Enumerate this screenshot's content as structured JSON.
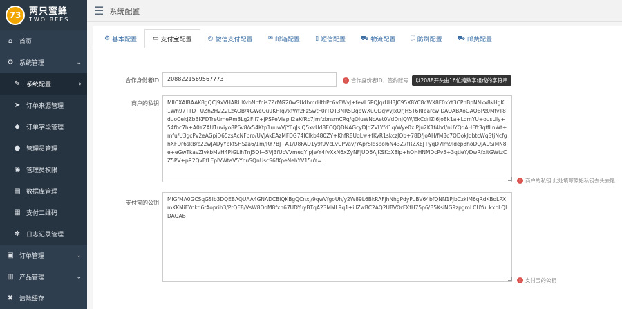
{
  "brand": {
    "badge": "73",
    "name_cn": "两只蜜蜂",
    "name_en": "TWO BEES"
  },
  "sidebar": {
    "items": [
      {
        "label": "首页",
        "icon": "home-icon",
        "glyph": "⌂",
        "arrow": ""
      },
      {
        "label": "系统管理",
        "icon": "gear-icon",
        "glyph": "⚙",
        "arrow": "⌄"
      },
      {
        "label": "系统配置",
        "icon": "wrench-icon",
        "glyph": "✎",
        "arrow": "›"
      },
      {
        "label": "订单来源管理",
        "icon": "send-icon",
        "glyph": "➤",
        "arrow": ""
      },
      {
        "label": "订单字段管理",
        "icon": "tag-icon",
        "glyph": "◆",
        "arrow": ""
      },
      {
        "label": "管理员管理",
        "icon": "user-icon",
        "glyph": "●",
        "arrow": ""
      },
      {
        "label": "管理员权限",
        "icon": "users-icon",
        "glyph": "◉",
        "arrow": ""
      },
      {
        "label": "数据库管理",
        "icon": "database-icon",
        "glyph": "▤",
        "arrow": ""
      },
      {
        "label": "支付二维码",
        "icon": "qrcode-icon",
        "glyph": "▦",
        "arrow": ""
      },
      {
        "label": "日志记录管理",
        "icon": "paw-icon",
        "glyph": "✽",
        "arrow": ""
      },
      {
        "label": "订单管理",
        "icon": "cart-icon",
        "glyph": "▣",
        "arrow": "⌄"
      },
      {
        "label": "产品管理",
        "icon": "product-icon",
        "glyph": "▥",
        "arrow": "⌄"
      },
      {
        "label": "清除缓存",
        "icon": "trash-icon",
        "glyph": "✖",
        "arrow": ""
      }
    ]
  },
  "topbar": {
    "title": "系统配置"
  },
  "tabs": [
    {
      "label": "基本配置",
      "glyph": "⚙"
    },
    {
      "label": "支付宝配置",
      "glyph": "▭"
    },
    {
      "label": "微信支付配置",
      "glyph": "◎"
    },
    {
      "label": "邮箱配置",
      "glyph": "✉"
    },
    {
      "label": "短信配置",
      "glyph": "▯"
    },
    {
      "label": "物流配置",
      "glyph": "⛟"
    },
    {
      "label": "防刷配置",
      "glyph": "⛶"
    },
    {
      "label": "邮费配置",
      "glyph": "⛟"
    }
  ],
  "form": {
    "partner": {
      "label": "合作身份者ID",
      "value": "2088221569567773",
      "hint": "合作身份者ID，签约账号",
      "tooltip": "以2088开头由16位纯数字组成的字符串"
    },
    "private_key": {
      "label": "商户的私钥",
      "value": "MIICXAIBAAK8gQCj9xVHARUKvbNpfnis7ZrMG20wSUdhmrHthPc6vFWvJ+feVL5PQJqrUH3JC95X8YC8cWX8F0xYt3CPhBpNNkx8kHgK1Wh97TTD+UZh2H2Z2LzAOB/4GWeOu9KHIq7xfWf2FzSwtF0rTOT3NR5DqpWXuQDqwvJxOrJHST6RIbarcwIDAQABAoGAQBPz0MfvT8duoCekJZbBKFDTreUmeRm3Lg2Fll7+jPSPeVIapll2aKfRc7JmfzbnsmCRq/gOIuWNcAet0VdDnJQW/EkCdrlZI6jo8k1a+LqmYU+ousUly+54fbc7h+A0YZAU1uviyo8P6v8/x54Ktp1uuwVjY6qJsiQ5xvUd8ECQQDNAGcyDJdZVLYfd1q/Wye0xlPJu2K1f4bd/nUYQqAHFft3qffLnWt+mfu/U3gcPv2eAGpjD65zsAcNFbro/UVJAkEAzMFDG74IClkb480ZY+KhfR8UqLw+fKyR1skczJQb+78D/JoAH/fM3c7ODokJdbtcWqStjNcfghXFDr6skB/c22wJADyYbkfSHSza6/1m/RY7BJ+A1/U8FAD1y9f9VcLvCPVav/YAprSldsbol6N43Z7fRZXEJ+yqD7lm9Idep8hoDQJAUSiMN8e+eGwTkavZIvkbMvH4PIGLlhTnJ5QI+5Vj3fUcVVmeqYIpJe/Y4fvXxN6xZyNFjUD6AJKSKoX8Ip+hOHHNMDcPv5+3qtieY/DwRfxitGWtzCZ5PV+pR2QvEfLEpIVWtaV5YnuSQnUscS6fKpeNehYV15uY=",
      "hint": "商户的私钥,此处填写原始私钥去头去尾"
    },
    "public_key": {
      "label": "支付宝的公钥",
      "value": "MIGfMA0GCSqGSIb3DQEBAQUAA4GNADCBiQKBgQCnxj/9qwVfgoUh/y2W89L6BkRAFjhNhgPdyPuBV64bfQNN1PJbCzkIM6qRdKBoLPXmKKMiFYnkd6rAoprih3/PrQE8/VsW8OoM8fxn67UDYuyBTqA23MML9q1+illZwBC2AQ2UBVOrFXfH75p6/B5KsiNG9zpgmLCUYuLkxpLQIDAQAB",
      "hint": "支付宝的公钥"
    }
  }
}
